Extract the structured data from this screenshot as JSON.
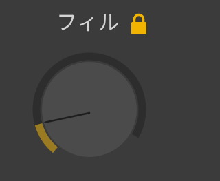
{
  "control": {
    "label": "フィル",
    "locked": true,
    "value_fraction": 0.13
  },
  "icons": {
    "lock": "lock-icon"
  },
  "colors": {
    "background": "#3b3b3b",
    "track": "#2d2d2d",
    "value_arc": "#9a7b22",
    "knob_body": "#4b4b4b",
    "pointer": "#1e1e1e",
    "label_text": "#d4d4d4",
    "lock": "#f2b400"
  }
}
